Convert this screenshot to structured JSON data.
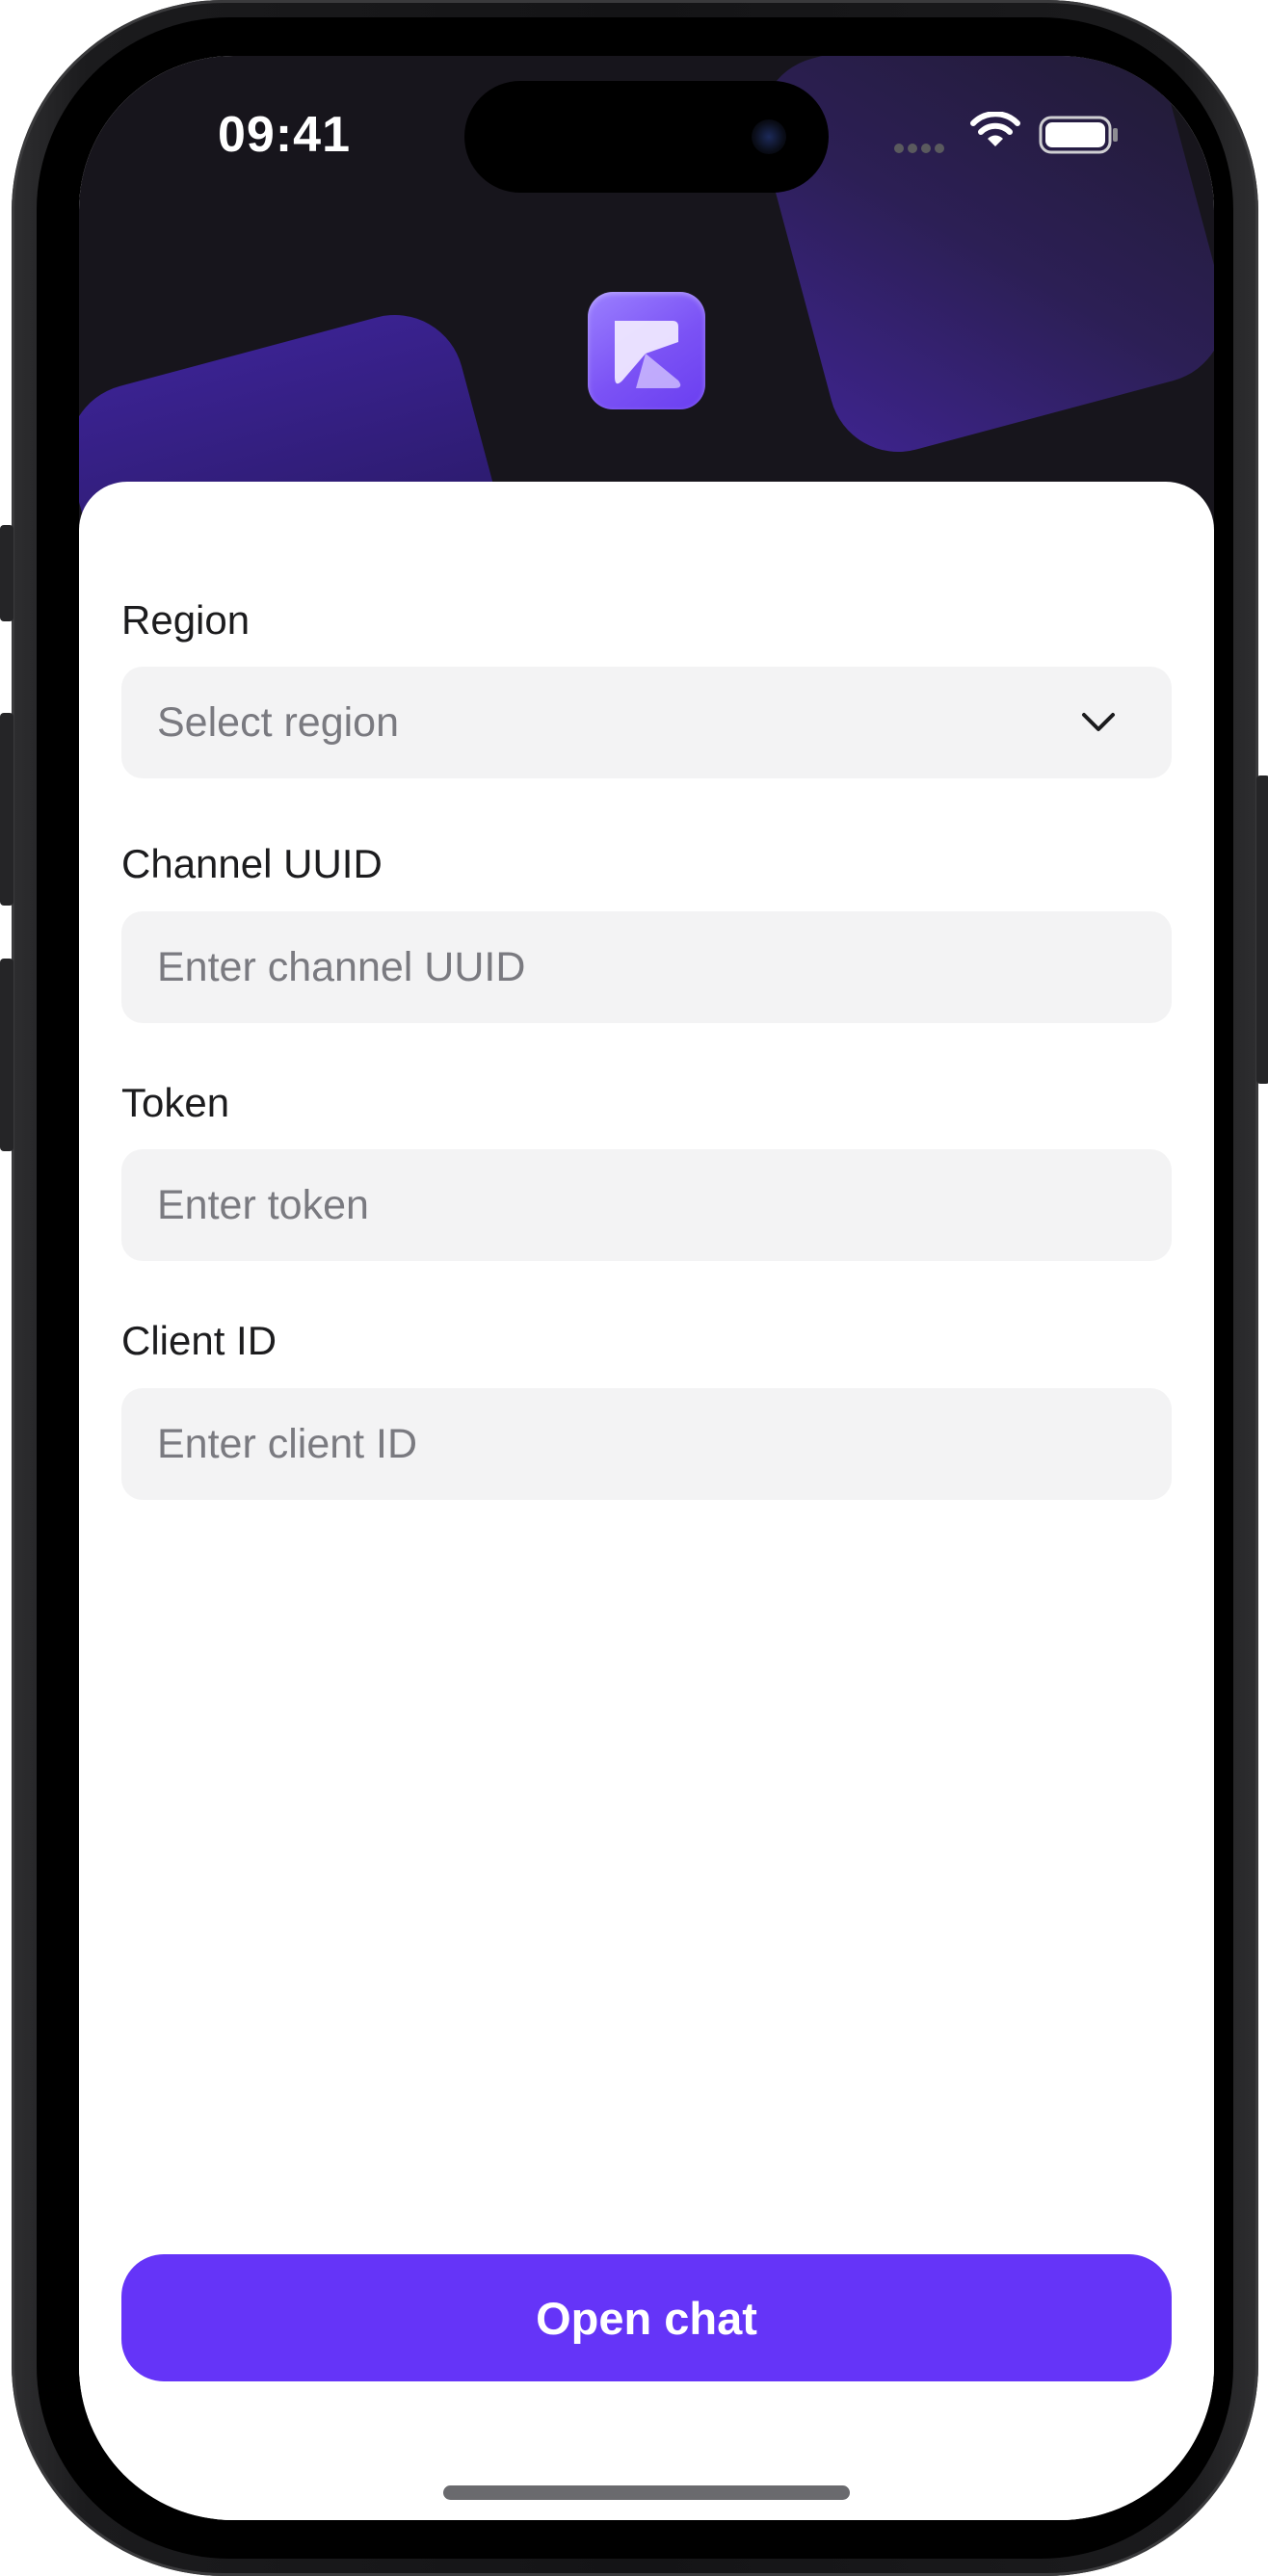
{
  "status_bar": {
    "time": "09:41",
    "icons": [
      "signal-dots-icon",
      "wifi-icon",
      "battery-icon"
    ]
  },
  "header": {
    "logo_icon": "app-logo-icon",
    "background_color": "#17151c",
    "accent_gradient": [
      "#3e2490",
      "#6a3ef0"
    ]
  },
  "form": {
    "region": {
      "label": "Region",
      "placeholder": "Select region",
      "icon": "chevron-down-icon"
    },
    "channel_uuid": {
      "label": "Channel UUID",
      "placeholder": "Enter channel UUID"
    },
    "token": {
      "label": "Token",
      "placeholder": "Enter token"
    },
    "client_id": {
      "label": "Client ID",
      "placeholder": "Enter client ID"
    }
  },
  "actions": {
    "open_chat_label": "Open chat",
    "primary_color": "#6534f8"
  },
  "colors": {
    "field_background": "#f3f3f4",
    "placeholder_text": "#7a7a80",
    "label_text": "#1c1c1e"
  }
}
